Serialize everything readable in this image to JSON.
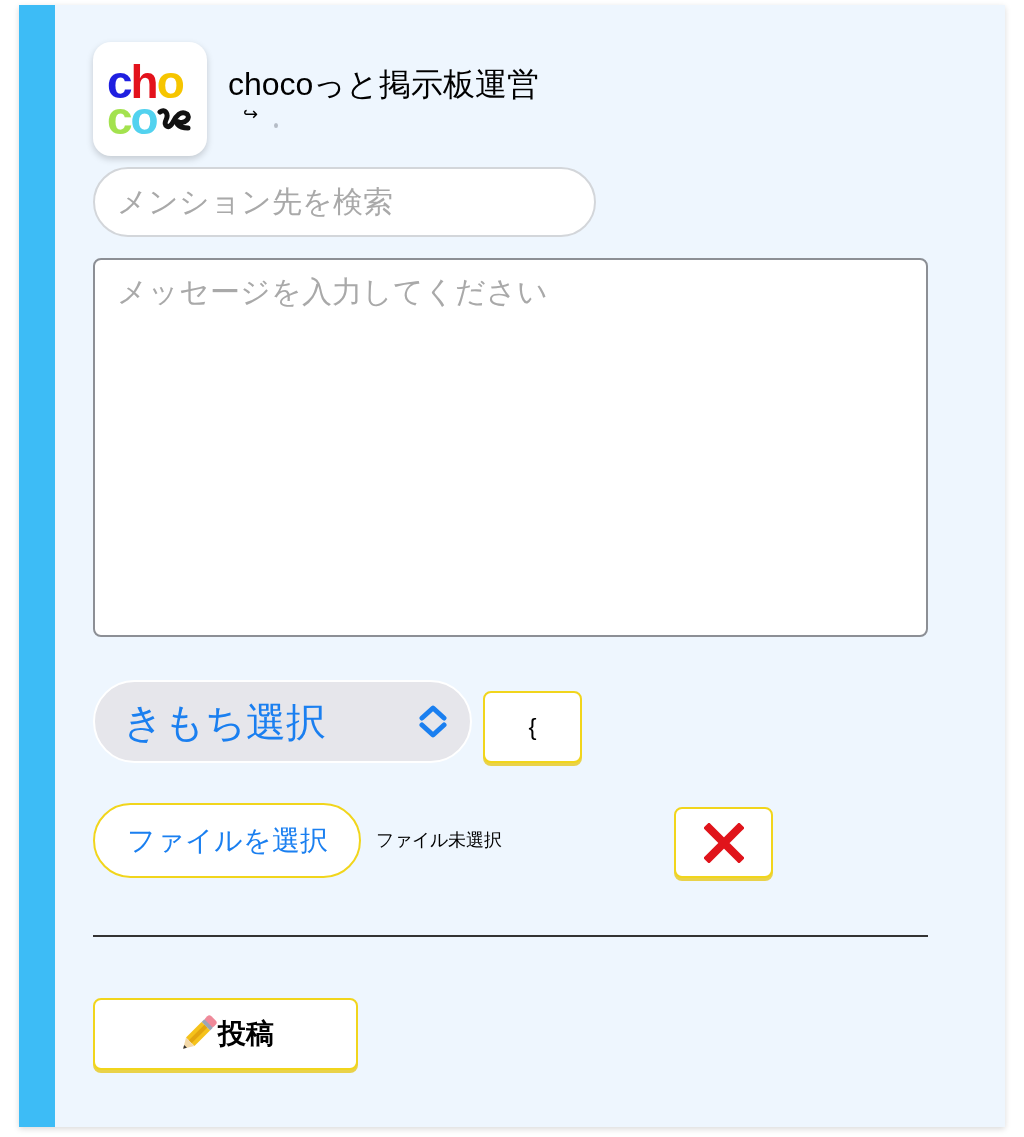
{
  "logo": {
    "lines": [
      "cho",
      "co"
    ]
  },
  "header": {
    "title": "chocoっと掲示板運営",
    "reply_mark": "↪"
  },
  "mention_search": {
    "placeholder": "メンション先を検索"
  },
  "message": {
    "placeholder": "メッセージを入力してください"
  },
  "mood_select": {
    "value": "きもち選択"
  },
  "brace_button": {
    "label": "{"
  },
  "file": {
    "button": "ファイルを選択",
    "status": "ファイル未選択"
  },
  "post_button": {
    "label": "投稿"
  }
}
